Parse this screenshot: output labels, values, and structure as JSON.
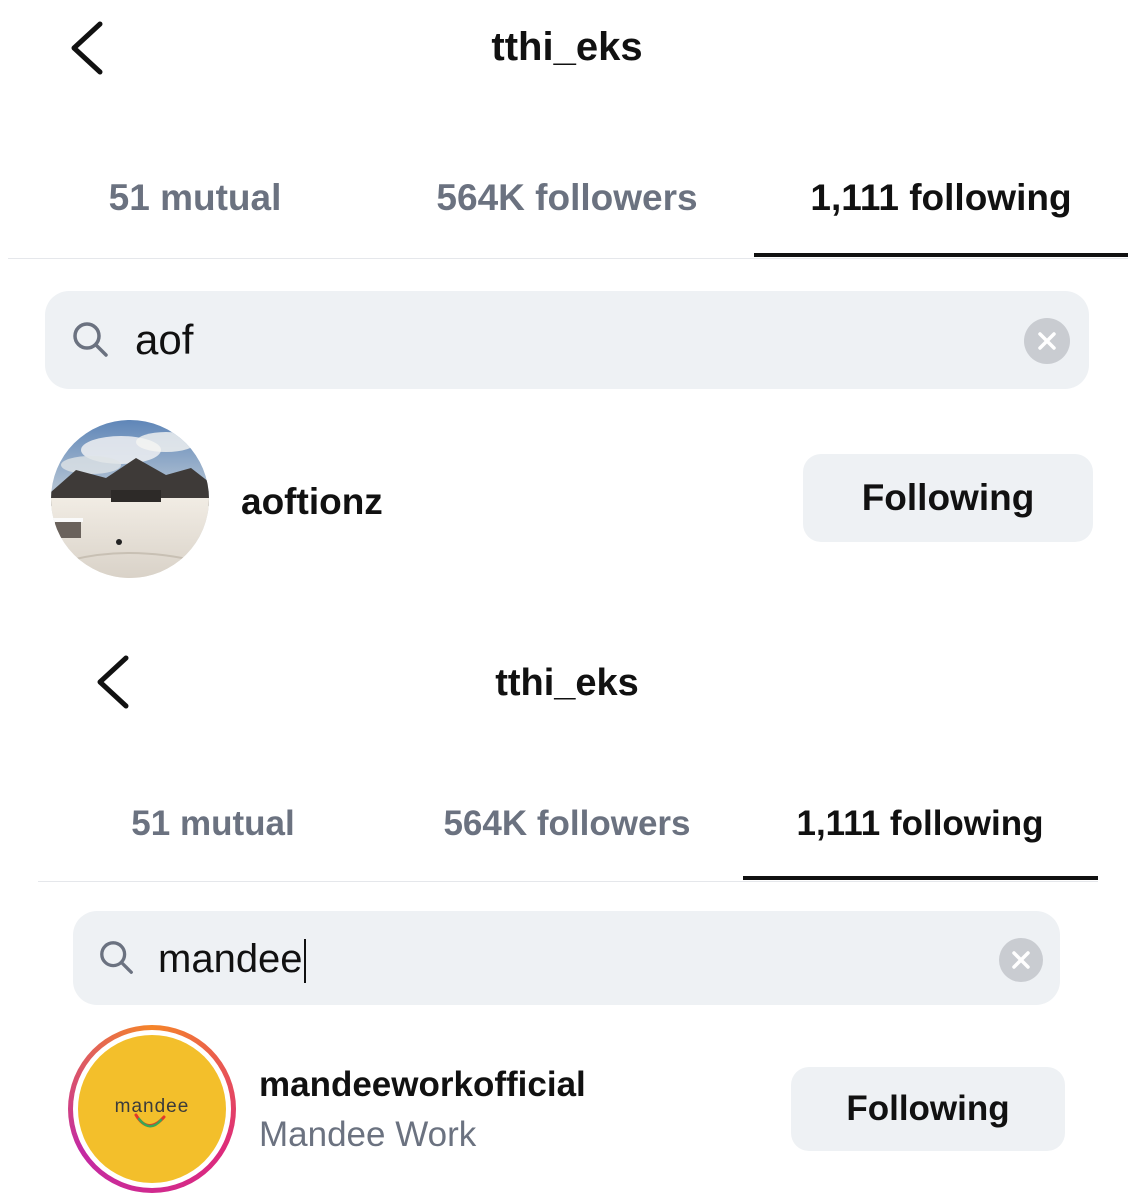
{
  "colors": {
    "accent": "#111111",
    "muted": "#6b7280",
    "search_bg": "#eef1f4",
    "button_bg": "#eef1f4",
    "avatar_yellow": "#f3bf2b",
    "story_ring": [
      "#f58529",
      "#dd2a7b",
      "#c32aa3"
    ]
  },
  "panels": [
    {
      "header": {
        "back_icon": "chevron-left-icon",
        "title": "tthi_eks"
      },
      "tabs": [
        {
          "label": "51 mutual",
          "active": false
        },
        {
          "label": "564K followers",
          "active": false
        },
        {
          "label": "1,111 following",
          "active": true
        }
      ],
      "search": {
        "value": "aof",
        "search_icon": "search-icon",
        "clear_icon": "clear-icon"
      },
      "results": [
        {
          "username": "aoftionz",
          "avatar": "snowy-landscape-avatar",
          "button": "Following"
        }
      ]
    },
    {
      "header": {
        "back_icon": "chevron-left-icon",
        "title": "tthi_eks"
      },
      "tabs": [
        {
          "label": "51 mutual",
          "active": false
        },
        {
          "label": "564K followers",
          "active": false
        },
        {
          "label": "1,111 following",
          "active": true
        }
      ],
      "search": {
        "value": "mandee",
        "search_icon": "search-icon",
        "clear_icon": "clear-icon"
      },
      "results": [
        {
          "username": "mandeeworkofficial",
          "full_name": "Mandee Work",
          "avatar": "mandee-logo-avatar",
          "avatar_text": "mandee",
          "button": "Following"
        }
      ]
    }
  ]
}
